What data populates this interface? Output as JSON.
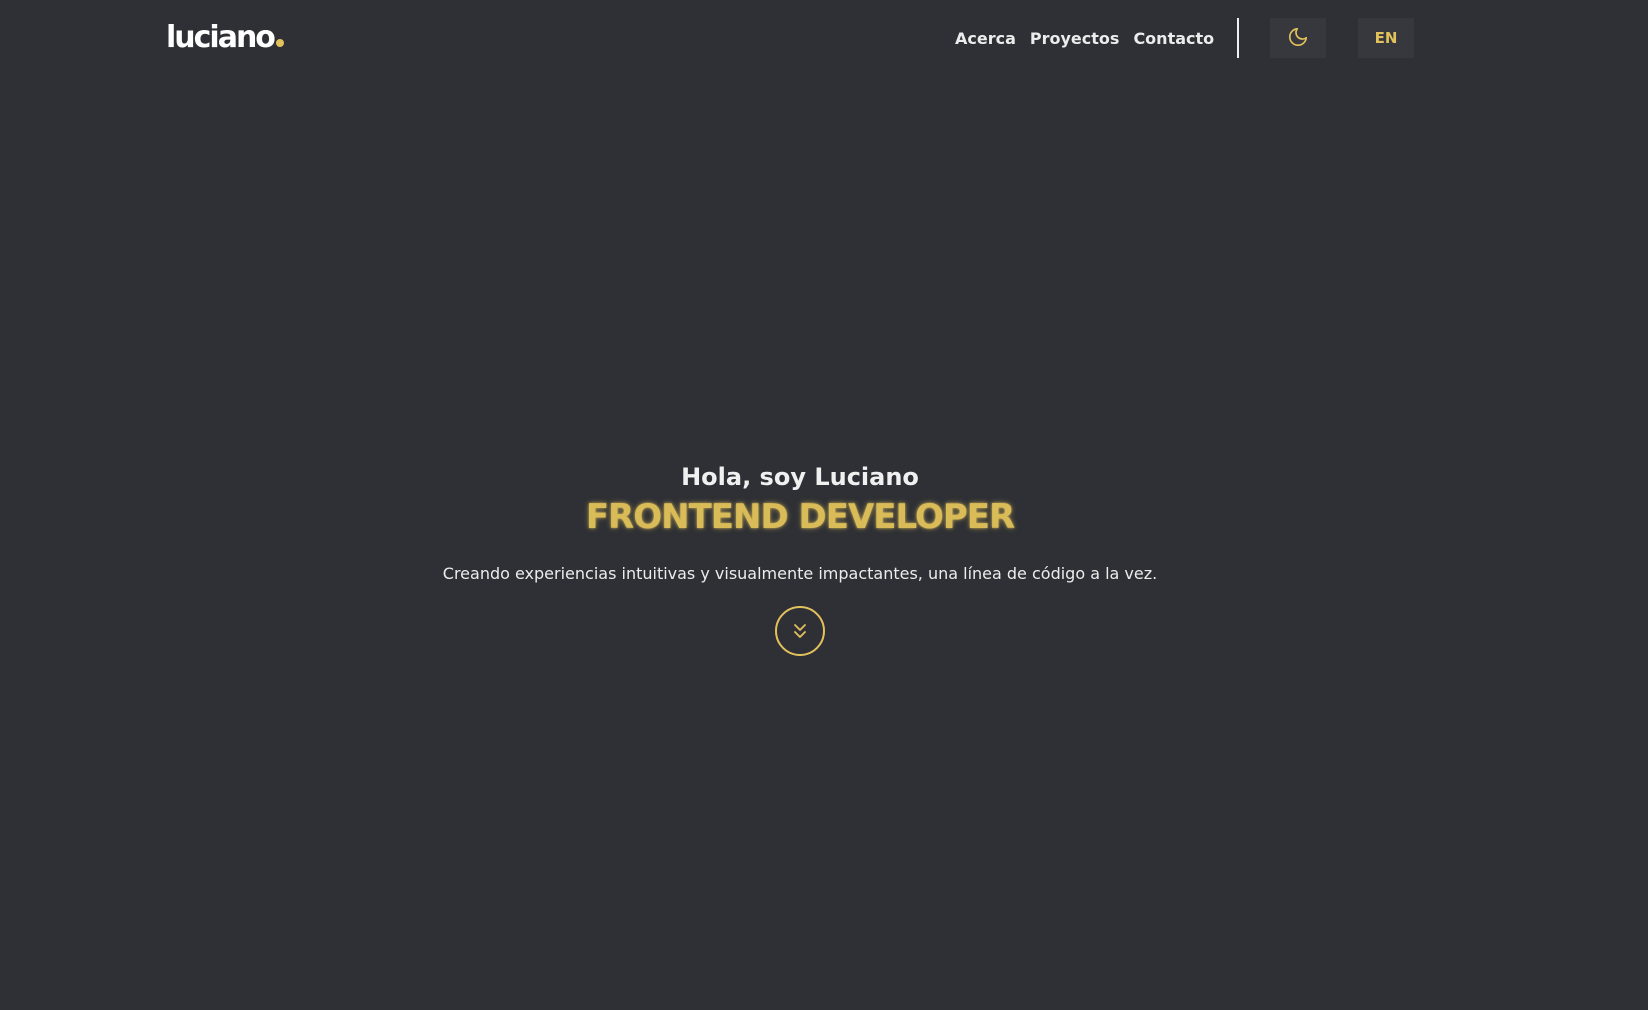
{
  "header": {
    "logo_text": "luciano",
    "nav": [
      {
        "label": "Acerca"
      },
      {
        "label": "Proyectos"
      },
      {
        "label": "Contacto"
      }
    ],
    "theme_toggle_icon": "moon-icon",
    "lang_toggle_label": "EN"
  },
  "hero": {
    "greeting": "Hola, soy Luciano",
    "role": "FRONTEND DEVELOPER",
    "tagline": "Creando experiencias intuitivas y visualmente impactantes, una línea de código a la vez.",
    "scroll_icon": "double-chevron-down-icon"
  },
  "colors": {
    "background": "#2e3035",
    "accent": "#e2c15c",
    "text": "#ececec",
    "button_bg": "#36383d"
  }
}
